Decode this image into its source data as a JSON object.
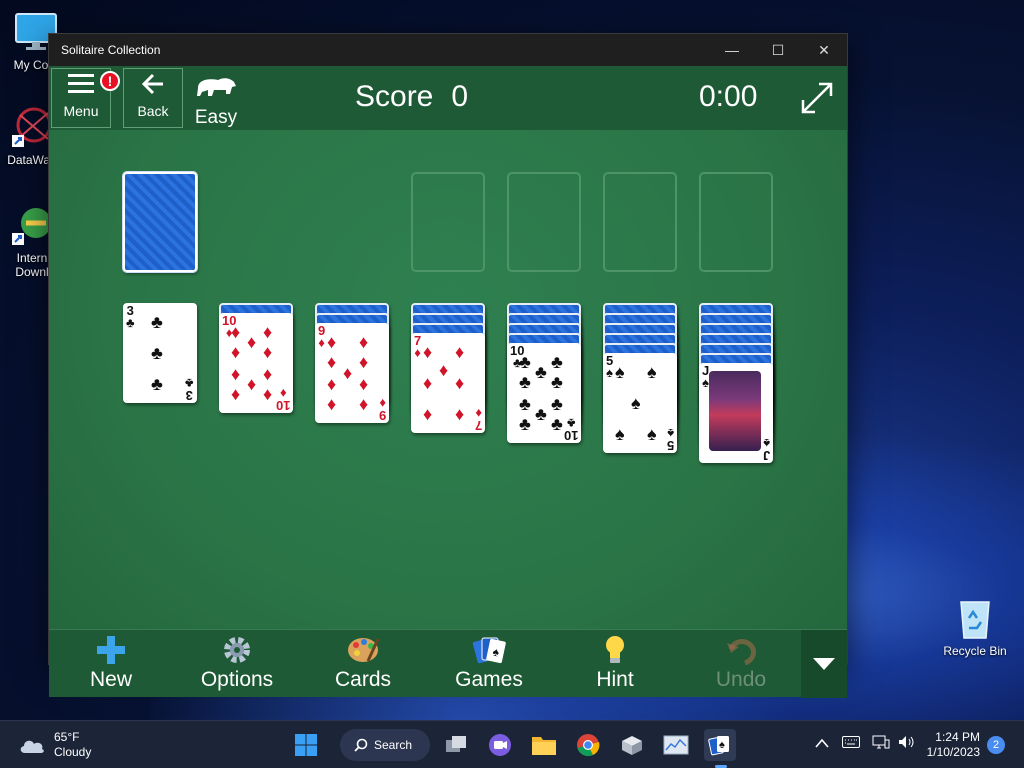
{
  "desktop": {
    "icons": [
      {
        "label": "My Com"
      },
      {
        "label": "DataWag"
      },
      {
        "label": "Intern\nDownl"
      },
      {
        "label": "Recycle Bin"
      }
    ]
  },
  "window": {
    "title": "Solitaire Collection",
    "controls": {
      "minimize": "—",
      "maximize": "☐",
      "close": "✕"
    }
  },
  "topbar": {
    "menu_label": "Menu",
    "menu_badge": "!",
    "back_label": "Back",
    "difficulty": "Easy",
    "score_label": "Score",
    "score_value": "0",
    "timer": "0:00"
  },
  "tableau": [
    {
      "face_down": 0,
      "top": {
        "rank": "3",
        "suit": "♣",
        "color": "black"
      }
    },
    {
      "face_down": 1,
      "top": {
        "rank": "10",
        "suit": "♦",
        "color": "red"
      }
    },
    {
      "face_down": 2,
      "top": {
        "rank": "9",
        "suit": "♦",
        "color": "red"
      }
    },
    {
      "face_down": 3,
      "top": {
        "rank": "7",
        "suit": "♦",
        "color": "red"
      }
    },
    {
      "face_down": 4,
      "top": {
        "rank": "10",
        "suit": "♣",
        "color": "black"
      }
    },
    {
      "face_down": 5,
      "top": {
        "rank": "5",
        "suit": "♠",
        "color": "black"
      }
    },
    {
      "face_down": 6,
      "top": {
        "rank": "J",
        "suit": "♠",
        "color": "black"
      }
    }
  ],
  "bottombar": {
    "new": "New",
    "options": "Options",
    "cards": "Cards",
    "games": "Games",
    "hint": "Hint",
    "undo": "Undo"
  },
  "taskbar": {
    "weather_temp": "65°F",
    "weather_desc": "Cloudy",
    "search_label": "Search",
    "time": "1:24 PM",
    "date": "1/10/2023",
    "notifications": "2"
  },
  "colors": {
    "felt": "#2a7446",
    "bar": "#1e5a35",
    "card_back": "#1f5fc9",
    "red_suit": "#d0152a",
    "accent": "#4a8df0"
  }
}
